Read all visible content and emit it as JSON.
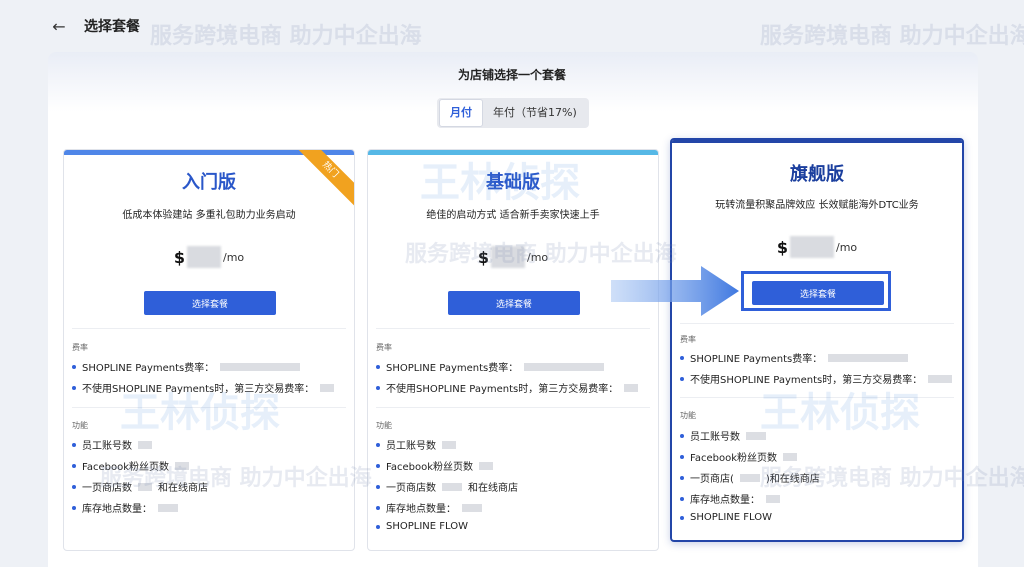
{
  "header": {
    "title": "选择套餐"
  },
  "page": {
    "heading": "为店铺选择一个套餐",
    "billing": {
      "monthly": "月付",
      "yearly": "年付（节省17%)"
    }
  },
  "plans": [
    {
      "name": "入门版",
      "desc": "低成本体验建站 多重礼包助力业务启动",
      "currency": "$",
      "unit": "/mo",
      "button": "选择套餐",
      "badge": "热门",
      "fee_title": "费率",
      "fees": [
        "SHOPLINE Payments费率：",
        "不使用SHOPLINE Payments时，第三方交易费率："
      ],
      "func_title": "功能",
      "features": [
        "员工账号数",
        "Facebook粉丝页数",
        "一页商店数",
        "库存地点数量："
      ],
      "feature_mid": "和在线商店"
    },
    {
      "name": "基础版",
      "desc": "绝佳的启动方式 适合新手卖家快速上手",
      "currency": "$",
      "unit": "/mo",
      "button": "选择套餐",
      "fee_title": "费率",
      "fees": [
        "SHOPLINE Payments费率：",
        "不使用SHOPLINE Payments时，第三方交易费率："
      ],
      "func_title": "功能",
      "features": [
        "员工账号数",
        "Facebook粉丝页数",
        "一页商店数",
        "库存地点数量：",
        "SHOPLINE FLOW"
      ],
      "feature_mid": "和在线商店"
    },
    {
      "name": "旗舰版",
      "desc": "玩转流量积聚品牌效应 长效赋能海外DTC业务",
      "currency": "$",
      "unit": "/mo",
      "button": "选择套餐",
      "fee_title": "费率",
      "fees": [
        "SHOPLINE Payments费率：",
        "不使用SHOPLINE Payments时，第三方交易费率："
      ],
      "func_title": "功能",
      "features": [
        "员工账号数",
        "Facebook粉丝页数",
        "一页商店(",
        "库存地点数量：",
        "SHOPLINE FLOW"
      ],
      "feature_mid": ")和在线商店"
    }
  ],
  "watermark": {
    "slogan": "服务跨境电商 助力中企出海",
    "logo": "王林侦探"
  },
  "colors": {
    "accent": "#2f5fd9",
    "badge": "#f1a21f"
  }
}
